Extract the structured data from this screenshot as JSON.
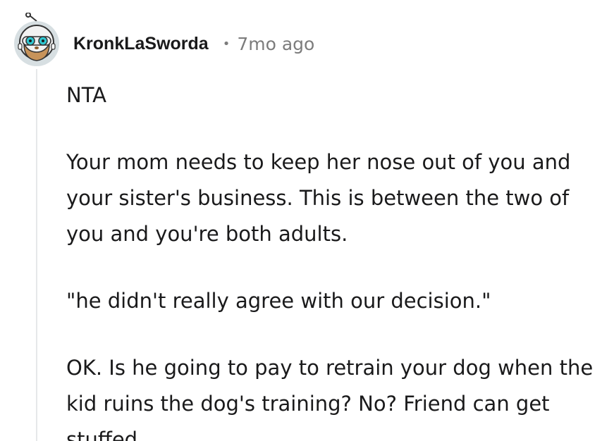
{
  "comment": {
    "username": "KronkLaSworda",
    "separator": "•",
    "timestamp": "7mo ago",
    "avatar_icon": "snoo-astronaut-avatar-icon",
    "paragraphs": [
      "NTA",
      "Your mom needs to keep her nose out of you and your sister's business. This is between the two of you and you're both adults.",
      "\"he didn't really agree with our decision.\"",
      "OK. Is he going to pay to retrain your dog when the kid ruins the dog's training? No? Friend can get stuffed."
    ]
  },
  "colors": {
    "text": "#1a1a1b",
    "meta": "#7c7c7c",
    "thread_line": "#e6e8ea",
    "avatar_bg": "#d7dfe2",
    "helmet": "#f2f2f2",
    "beard": "#c7935a",
    "visor": "#2fc6d0"
  }
}
